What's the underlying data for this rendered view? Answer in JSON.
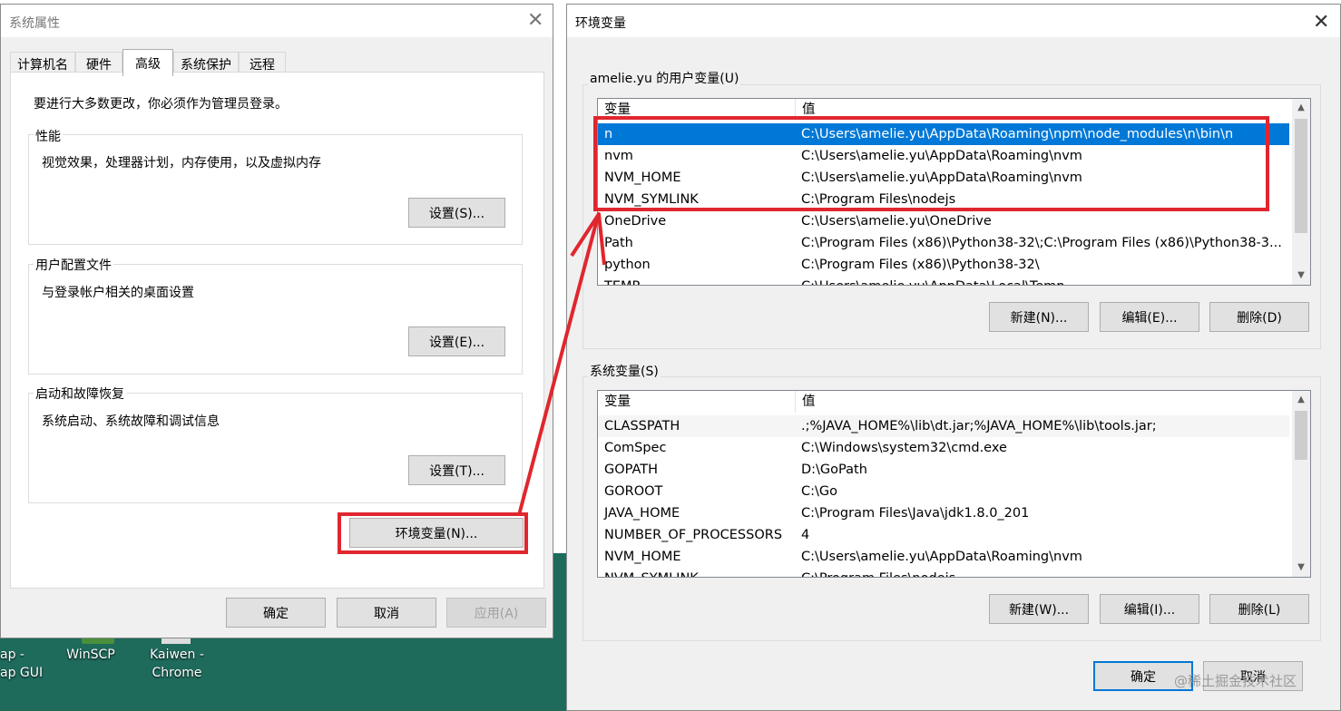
{
  "system_props": {
    "title": "系统属性",
    "tabs": [
      "计算机名",
      "硬件",
      "高级",
      "系统保护",
      "远程"
    ],
    "admin_note": "要进行大多数更改，你必须作为管理员登录。",
    "perf": {
      "label": "性能",
      "desc": "视觉效果，处理器计划，内存使用，以及虚拟内存",
      "button": "设置(S)..."
    },
    "profile": {
      "label": "用户配置文件",
      "desc": "与登录帐户相关的桌面设置",
      "button": "设置(E)..."
    },
    "startup": {
      "label": "启动和故障恢复",
      "desc": "系统启动、系统故障和调试信息",
      "button": "设置(T)..."
    },
    "env_button": "环境变量(N)...",
    "ok": "确定",
    "cancel": "取消",
    "apply": "应用(A)"
  },
  "env_vars": {
    "title": "环境变量",
    "user_section": "amelie.yu 的用户变量(U)",
    "system_section": "系统变量(S)",
    "col_var": "变量",
    "col_val": "值",
    "user_rows": [
      {
        "name": "n",
        "value": "C:\\Users\\amelie.yu\\AppData\\Roaming\\npm\\node_modules\\n\\bin\\n"
      },
      {
        "name": "nvm",
        "value": "C:\\Users\\amelie.yu\\AppData\\Roaming\\nvm"
      },
      {
        "name": "NVM_HOME",
        "value": "C:\\Users\\amelie.yu\\AppData\\Roaming\\nvm"
      },
      {
        "name": "NVM_SYMLINK",
        "value": "C:\\Program Files\\nodejs"
      },
      {
        "name": "OneDrive",
        "value": "C:\\Users\\amelie.yu\\OneDrive"
      },
      {
        "name": "Path",
        "value": "C:\\Program Files (x86)\\Python38-32\\;C:\\Program Files (x86)\\Python38-3..."
      },
      {
        "name": "python",
        "value": "C:\\Program Files (x86)\\Python38-32\\"
      },
      {
        "name": "TEMP",
        "value": "C:\\Users\\amelie.yu\\AppData\\Local\\Temp"
      }
    ],
    "system_rows": [
      {
        "name": "CLASSPATH",
        "value": ".;%JAVA_HOME%\\lib\\dt.jar;%JAVA_HOME%\\lib\\tools.jar;"
      },
      {
        "name": "ComSpec",
        "value": "C:\\Windows\\system32\\cmd.exe"
      },
      {
        "name": "GOPATH",
        "value": "D:\\GoPath"
      },
      {
        "name": "GOROOT",
        "value": "C:\\Go"
      },
      {
        "name": "JAVA_HOME",
        "value": "C:\\Program Files\\Java\\jdk1.8.0_201"
      },
      {
        "name": "NUMBER_OF_PROCESSORS",
        "value": "4"
      },
      {
        "name": "NVM_HOME",
        "value": "C:\\Users\\amelie.yu\\AppData\\Roaming\\nvm"
      },
      {
        "name": "NVM_SYMLINK",
        "value": "C:\\Program Files\\nodejs"
      }
    ],
    "user_buttons": [
      "新建(N)...",
      "编辑(E)...",
      "删除(D)"
    ],
    "system_buttons": [
      "新建(W)...",
      "编辑(I)...",
      "删除(L)"
    ],
    "ok": "确定",
    "cancel": "取消"
  },
  "desktop": {
    "icons": [
      {
        "label": "ap -\nap GUI"
      },
      {
        "label": "WinSCP"
      },
      {
        "label": "Kaiwen -\nChrome"
      }
    ],
    "watermark": "@稀土掘金技术社区"
  },
  "colors": {
    "highlight": "#e0262e",
    "selection": "#0078d7",
    "desktop": "#1e6b5c"
  }
}
